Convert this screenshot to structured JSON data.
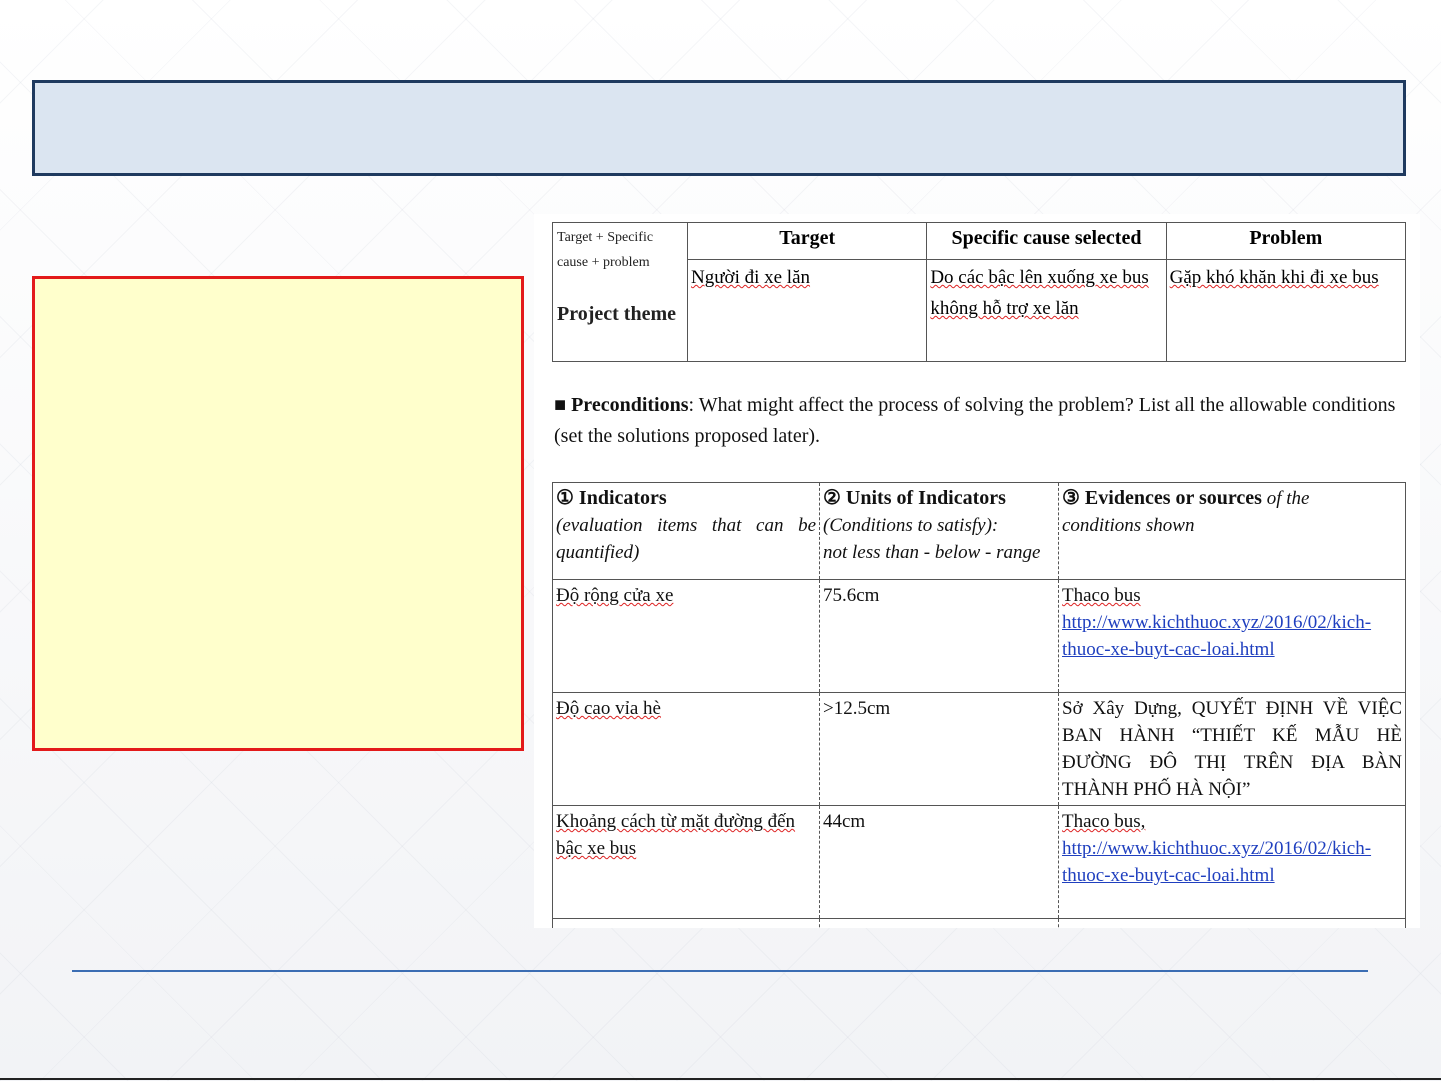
{
  "project_table": {
    "label_small": "Target + Specific cause + problem",
    "label_theme": "Project theme",
    "headers": [
      "Target",
      "Specific cause selected",
      "Problem"
    ],
    "values": [
      "Người đi xe lăn",
      "Do các bậc lên xuống xe bus không hỗ trợ xe lăn",
      "Gặp khó khăn khi đi xe bus"
    ]
  },
  "preconditions": {
    "bullet": "■",
    "label": "Preconditions",
    "text": ": What might affect the process of solving the problem? List all the allowable conditions (set the solutions proposed later)."
  },
  "conditions_table": {
    "col1_title": "① Indicators",
    "col1_sub": "(evaluation items that can be quantified)",
    "col2_title": "② Units of Indicators",
    "col2_sub1": "(Conditions to satisfy):",
    "col2_sub2": "not less than - below - range",
    "col3_title": "③ Evidences or sources",
    "col3_title_it": " of the",
    "col3_sub": "conditions shown",
    "rows": [
      {
        "indicator": "Độ rộng cửa xe",
        "unit": "75.6cm",
        "source": "Thaco bus",
        "link": "http://www.kichthuoc.xyz/2016/02/kich-thuoc-xe-buyt-cac-loai.html"
      },
      {
        "indicator": "Độ cao vỉa hè",
        "unit": ">12.5cm",
        "source": "Sở Xây Dựng, QUYẾT ĐỊNH VỀ VIỆC BAN HÀNH “THIẾT KẾ MẪU HÈ ĐƯỜNG ĐÔ THỊ TRÊN ĐỊA BÀN THÀNH PHỐ HÀ NỘI”",
        "link": ""
      },
      {
        "indicator": "Khoảng cách từ mặt đường đến bậc xe bus",
        "unit": "44cm",
        "source": "Thaco bus,",
        "link": "http://www.kichthuoc.xyz/2016/02/kich-thuoc-xe-buyt-cac-loai.html"
      }
    ]
  },
  "colors": {
    "title_bar_fill": "#dbe5f1",
    "title_bar_border": "#1f3a5f",
    "note_fill": "#ffffcc",
    "note_border": "#e31a1a",
    "link": "#1f3fbf"
  }
}
